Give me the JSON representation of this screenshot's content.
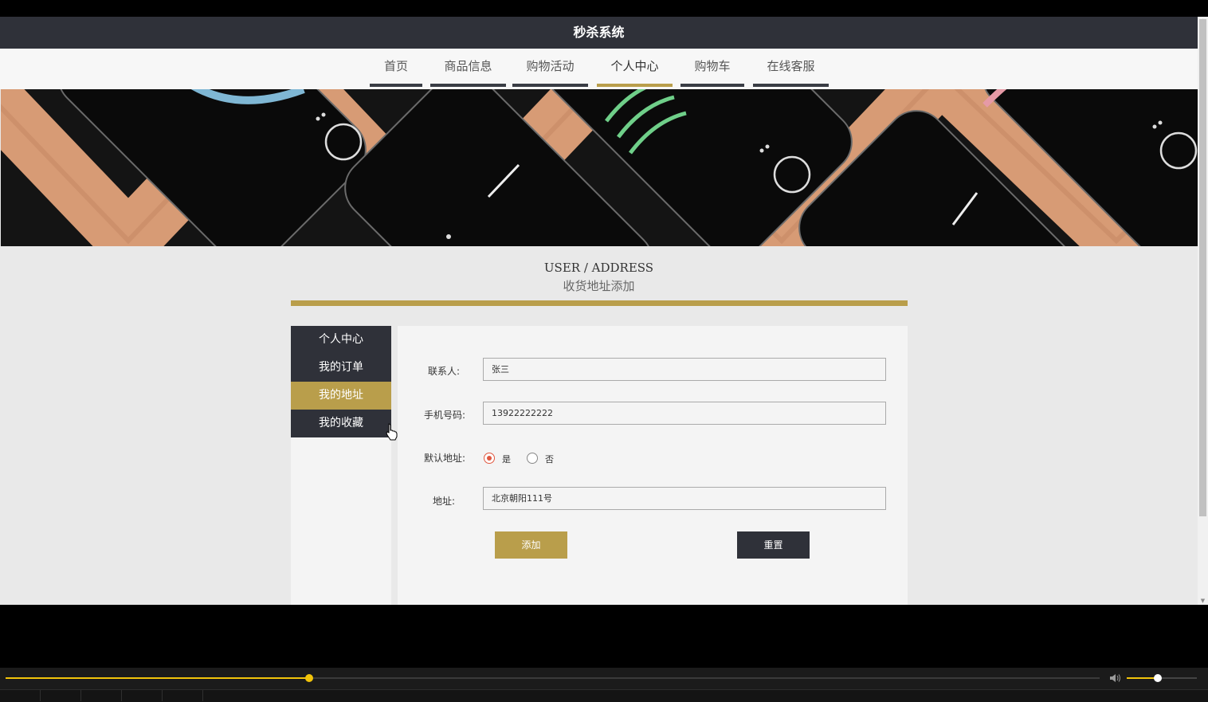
{
  "header": {
    "title": "秒杀系统"
  },
  "nav": {
    "items": [
      {
        "label": "首页"
      },
      {
        "label": "商品信息"
      },
      {
        "label": "购物活动"
      },
      {
        "label": "个人中心"
      },
      {
        "label": "购物车"
      },
      {
        "label": "在线客服"
      }
    ],
    "active": "个人中心"
  },
  "section": {
    "title_en": "USER / ADDRESS",
    "title_cn": "收货地址添加"
  },
  "sidebar": {
    "items": [
      {
        "label": "个人中心"
      },
      {
        "label": "我的订单"
      },
      {
        "label": "我的地址"
      },
      {
        "label": "我的收藏"
      }
    ],
    "active": "我的地址"
  },
  "form": {
    "contact_label": "联系人:",
    "contact_value": "张三",
    "phone_label": "手机号码:",
    "phone_value": "13922222222",
    "default_label": "默认地址:",
    "default_yes": "是",
    "default_no": "否",
    "default_selected": "是",
    "address_label": "地址:",
    "address_value": "北京朝阳111号",
    "add_button": "添加",
    "reset_button": "重置"
  },
  "colors": {
    "accent_gold": "#b99e4b",
    "dark": "#2f3139",
    "progress": "#f2c40a"
  },
  "player": {
    "progress": 0.28,
    "volume": 0.45
  }
}
